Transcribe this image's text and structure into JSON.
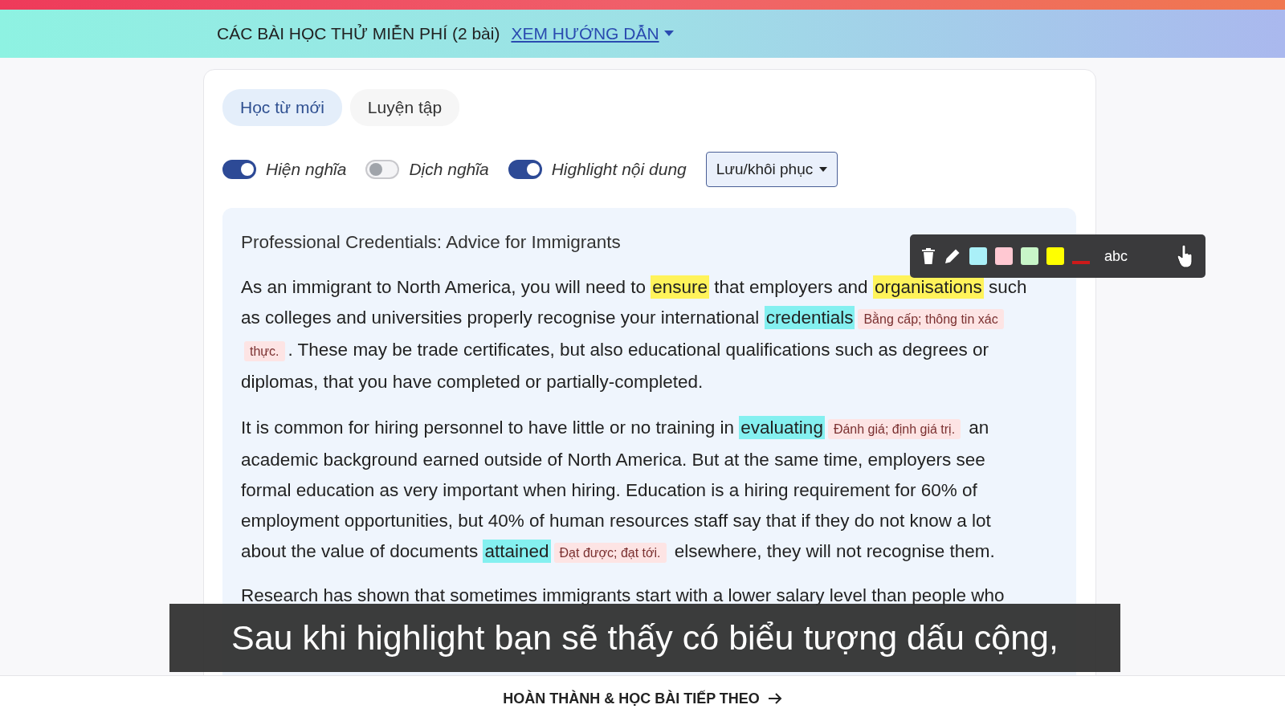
{
  "banner": {
    "title": "CÁC BÀI HỌC THỬ MIỄN PHÍ (2 bài)",
    "link": "XEM HƯỚNG DẪN"
  },
  "tabs": [
    {
      "label": "Học từ mới",
      "selected": true
    },
    {
      "label": "Luyện tập",
      "selected": false
    }
  ],
  "toggles": [
    {
      "label": "Hiện nghĩa",
      "on": true
    },
    {
      "label": "Dịch nghĩa",
      "on": false
    },
    {
      "label": "Highlight nội dung",
      "on": true
    }
  ],
  "save_menu": {
    "label": "Lưu/khôi phục"
  },
  "article": {
    "title": "Professional Credentials: Advice for Immigrants",
    "paragraphs": [
      [
        {
          "text": "As an immigrant to North America, you will need to "
        },
        {
          "text": "ensure",
          "color": "#fff35a"
        },
        {
          "text": " that employers and "
        },
        {
          "text": "organisations",
          "color": "#fff35a"
        },
        {
          "text": " such as colleges and universities properly recognise your international "
        },
        {
          "text": "credentials",
          "color": "#84f0f0",
          "gloss": "Bằng cấp; thông tin xác thực."
        },
        {
          "text": ". These may be trade certificates, but also educational qualifications such as degrees or diplomas, that you have completed or partially-completed."
        }
      ],
      [
        {
          "text": "It is common for hiring personnel to have little or no training in "
        },
        {
          "text": "evaluating",
          "color": "#84f0f0",
          "gloss": "Đánh giá; định giá trị."
        },
        {
          "text": " an academic background earned outside of North America. But at the same time, employers see formal education as very important when hiring. Education is a hiring requirement for 60% of employment opportunities, but 40% of human resources staff say that if they do not know a lot about the value of documents "
        },
        {
          "text": "attained",
          "color": "#84f0f0",
          "gloss": "Đạt được; đạt tới."
        },
        {
          "text": " elsewhere, they will not recognise them."
        }
      ]
    ],
    "partial_line": "Research has shown that sometimes immigrants start with a lower salary level than people who"
  },
  "highlight_toolbar": {
    "swatches": [
      {
        "color": "#aaf0f8"
      },
      {
        "color": "#ffc8d2"
      },
      {
        "color": "#c8f5c8"
      },
      {
        "color": "#ffff00"
      }
    ],
    "text_label": "abc"
  },
  "caption": "Sau khi highlight bạn sẽ thấy có biểu tượng dấu cộng,",
  "footer": {
    "button": "HOÀN THÀNH & HỌC BÀI TIẾP THEO"
  }
}
